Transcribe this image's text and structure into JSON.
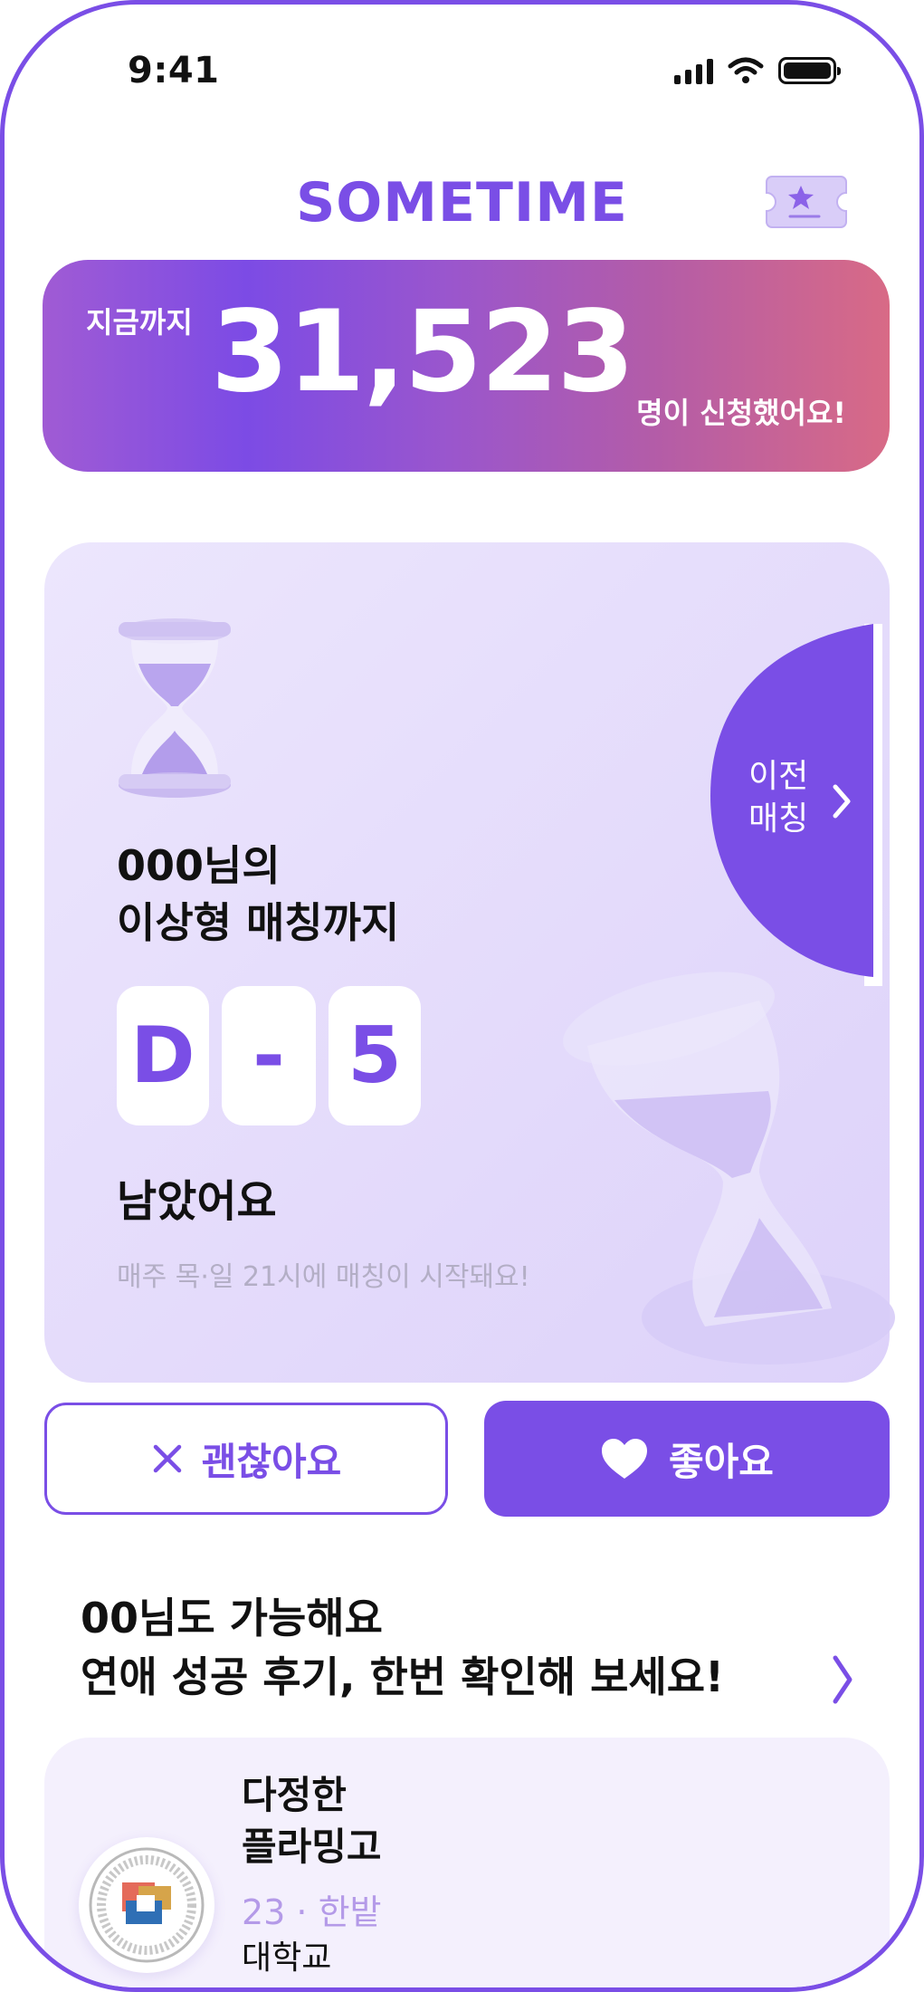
{
  "status_bar": {
    "time": "9:41"
  },
  "header": {
    "logo": "SOMETIME",
    "ticket_icon": "star-ticket-icon"
  },
  "counter": {
    "prefix": "지금까지",
    "number": "31,523",
    "suffix": "명이 신청했어요!"
  },
  "match_card": {
    "title_line1": "000님의",
    "title_line2": "이상형 매칭까지",
    "dday": [
      "D",
      "-",
      "5"
    ],
    "remaining": "남았어요",
    "note": "매주 목·일 21시에 매칭이 시작돼요!",
    "prev_match_line1": "이전",
    "prev_match_line2": "매칭"
  },
  "actions": {
    "pass_label": "괜찮아요",
    "like_label": "좋아요"
  },
  "reviews": {
    "heading_line1": "00님도 가능해요",
    "heading_line2": "연애 성공 후기, 한번 확인해 보세요!",
    "items": [
      {
        "name_line1": "다정한",
        "name_line2": "플라밍고",
        "meta": "23 · 한밭",
        "school": "대학교"
      }
    ]
  },
  "colors": {
    "primary": "#7a4ee6",
    "card_bg": "#ece6fd",
    "gradient_end": "#d86a86"
  }
}
